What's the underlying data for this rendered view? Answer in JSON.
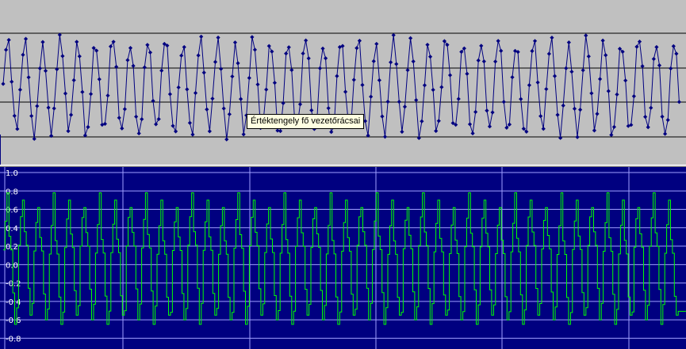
{
  "tooltip": {
    "text": "Értéktengely fő vezetőrácsai"
  },
  "chart_data": [
    {
      "type": "line",
      "series": [
        {
          "color": "#000080",
          "marker": "diamond",
          "period_samples": 6.2,
          "samples": 240
        }
      ],
      "gridlines": "horizontal",
      "grid": true
    },
    {
      "type": "line",
      "yticks": [
        "1.0",
        "0.8",
        "0.6",
        "0.4",
        "0.2",
        "0.0",
        "-0.2",
        "-0.4",
        "-0.6",
        "-0.8"
      ],
      "ylim": [
        -0.9,
        1.0
      ],
      "series": [
        {
          "color": "#00ff00",
          "step": true,
          "min": -0.65,
          "max": 0.78
        }
      ],
      "grid": true,
      "background": "#000080",
      "gridline_color": "#a0a0ff"
    }
  ]
}
